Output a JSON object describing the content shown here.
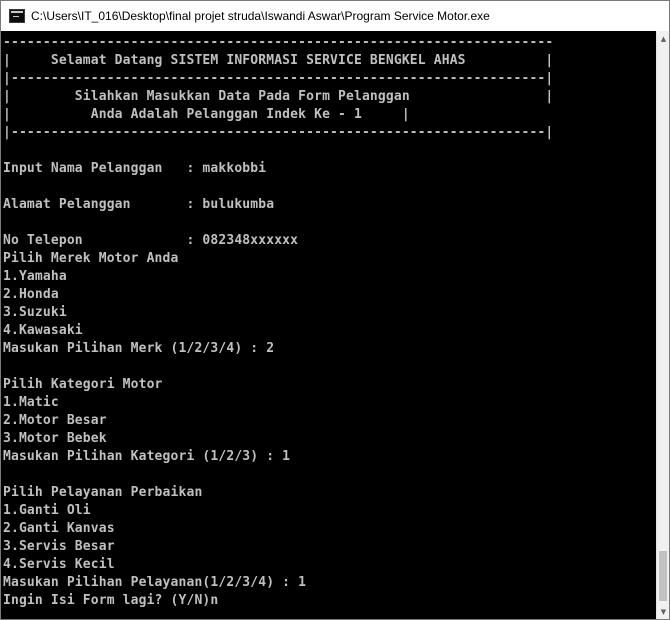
{
  "window": {
    "title": "C:\\Users\\IT_016\\Desktop\\final projet struda\\Iswandi Aswar\\Program Service Motor.exe",
    "title_icon": "console-app-icon"
  },
  "colors": {
    "console_bg": "#000000",
    "console_text": "#c0c0c0",
    "titlebar_bg": "#ffffff",
    "scrollbar_bg": "#f0f0f0"
  },
  "console": {
    "lines": [
      "---------------------------------------------------------------------",
      "|     Selamat Datang SISTEM INFORMASI SERVICE BENGKEL AHAS          |",
      "|-------------------------------------------------------------------|",
      "|        Silahkan Masukkan Data Pada Form Pelanggan                 |",
      "|          Anda Adalah Pelanggan Indek Ke - 1     |",
      "|-------------------------------------------------------------------|",
      "",
      "Input Nama Pelanggan   : makkobbi",
      "",
      "Alamat Pelanggan       : bulukumba",
      "",
      "No Telepon             : 082348xxxxxx",
      "Pilih Merek Motor Anda",
      "1.Yamaha",
      "2.Honda",
      "3.Suzuki",
      "4.Kawasaki",
      "Masukan Pilihan Merk (1/2/3/4) : 2",
      "",
      "Pilih Kategori Motor",
      "1.Matic",
      "2.Motor Besar",
      "3.Motor Bebek",
      "Masukan Pilihan Kategori (1/2/3) : 1",
      "",
      "Pilih Pelayanan Perbaikan",
      "1.Ganti Oli",
      "2.Ganti Kanvas",
      "3.Servis Besar",
      "4.Servis Kecil",
      "Masukan Pilihan Pelayanan(1/2/3/4) : 1",
      "Ingin Isi Form lagi? (Y/N)n"
    ]
  },
  "scrollbar": {
    "up_arrow": "▲",
    "down_arrow": "▼"
  }
}
